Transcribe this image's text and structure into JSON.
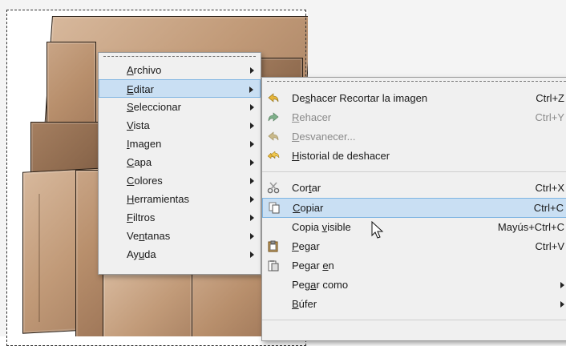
{
  "main_menu": {
    "items": [
      {
        "pre": "",
        "u": "A",
        "post": "rchivo"
      },
      {
        "pre": "",
        "u": "E",
        "post": "ditar"
      },
      {
        "pre": "",
        "u": "S",
        "post": "eleccionar"
      },
      {
        "pre": "",
        "u": "V",
        "post": "ista"
      },
      {
        "pre": "",
        "u": "I",
        "post": "magen"
      },
      {
        "pre": "",
        "u": "C",
        "post": "apa"
      },
      {
        "pre": "",
        "u": "C",
        "post": "olores"
      },
      {
        "pre": "",
        "u": "H",
        "post": "erramientas"
      },
      {
        "pre": "",
        "u": "F",
        "post": "iltros"
      },
      {
        "pre": "Ve",
        "u": "n",
        "post": "tanas"
      },
      {
        "pre": "Ay",
        "u": "u",
        "post": "da"
      }
    ]
  },
  "edit_menu": {
    "undo": {
      "pre": "De",
      "u": "s",
      "post": "hacer Recortar la imagen",
      "shortcut": "Ctrl+Z"
    },
    "redo": {
      "pre": "",
      "u": "R",
      "post": "ehacer",
      "shortcut": "Ctrl+Y"
    },
    "fade": {
      "pre": "",
      "u": "D",
      "post": "esvanecer...",
      "shortcut": ""
    },
    "history": {
      "pre": "",
      "u": "H",
      "post": "istorial de deshacer",
      "shortcut": ""
    },
    "cut": {
      "pre": "Cor",
      "u": "t",
      "post": "ar",
      "shortcut": "Ctrl+X"
    },
    "copy": {
      "pre": "",
      "u": "C",
      "post": "opiar",
      "shortcut": "Ctrl+C"
    },
    "copy_visible": {
      "pre": "Copia ",
      "u": "v",
      "post": "isible",
      "shortcut": "Mayús+Ctrl+C"
    },
    "paste": {
      "pre": "",
      "u": "P",
      "post": "egar",
      "shortcut": "Ctrl+V"
    },
    "paste_in": {
      "pre": "Pegar ",
      "u": "e",
      "post": "n",
      "shortcut": ""
    },
    "paste_as": {
      "pre": "Peg",
      "u": "a",
      "post": "r como",
      "shortcut": ""
    },
    "buffer": {
      "pre": "",
      "u": "B",
      "post": "úfer",
      "shortcut": ""
    }
  },
  "colors": {
    "highlight": "#c9dff3",
    "highlight_border": "#7eb4e2",
    "menu_bg": "#f0f0f0"
  }
}
